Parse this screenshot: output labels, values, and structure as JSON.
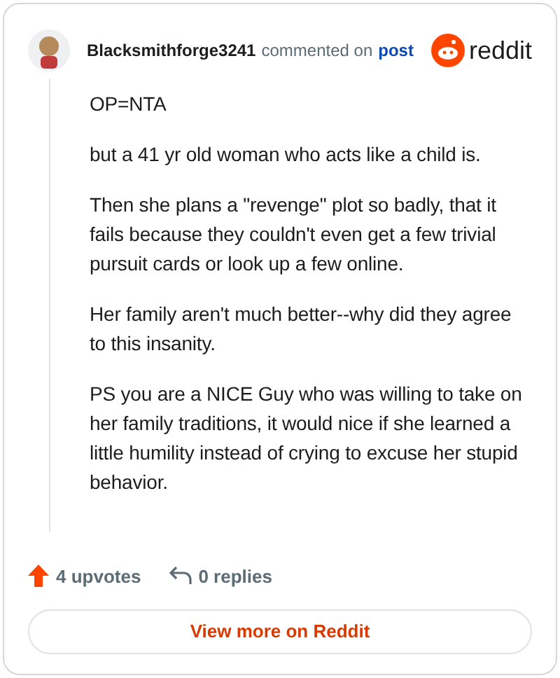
{
  "header": {
    "username": "Blacksmithforge3241",
    "action": "commented on",
    "link": "post",
    "logo_text": "reddit"
  },
  "comment": {
    "paragraphs": [
      "OP=NTA",
      "but a 41 yr old woman who acts like a child is.",
      "Then she plans a \"revenge\" plot so badly, that it fails because they couldn't even get a few trivial pursuit cards or look up a few online.",
      "Her family aren't much better--why did they agree to this insanity.",
      "PS you are a NICE Guy who was willing to take on her family traditions, it would nice if she learned a little humility instead of crying to excuse her stupid behavior."
    ]
  },
  "stats": {
    "upvotes": "4 upvotes",
    "replies": "0 replies"
  },
  "button": "View more on Reddit"
}
